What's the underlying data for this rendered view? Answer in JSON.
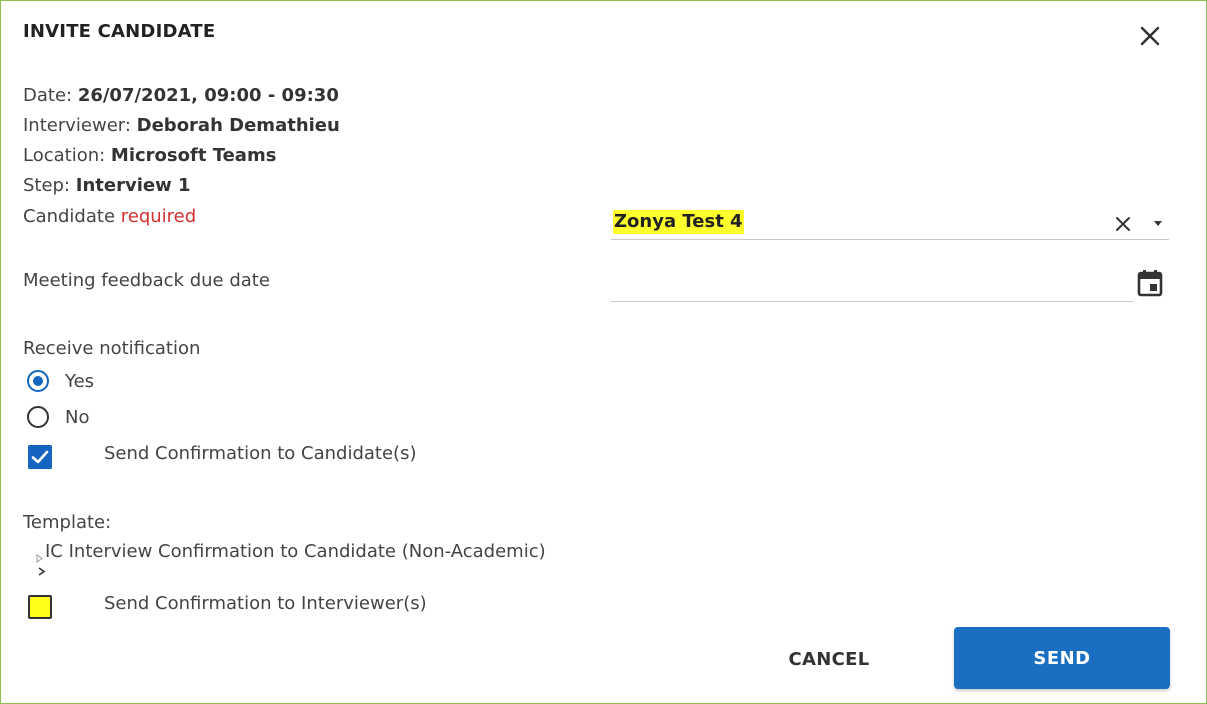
{
  "dialog": {
    "title": "INVITE CANDIDATE",
    "close_icon": "close-icon"
  },
  "info": {
    "date_label": "Date: ",
    "date_value": "26/07/2021, 09:00 - 09:30",
    "interviewer_label": "Interviewer: ",
    "interviewer_value": "Deborah Demathieu",
    "location_label": "Location: ",
    "location_value": "Microsoft Teams",
    "step_label": "Step: ",
    "step_value": "Interview 1"
  },
  "candidate": {
    "label": "Candidate",
    "required": "required",
    "value": "Zonya Test 4",
    "highlight_color": "#ffff2e"
  },
  "feedback_due": {
    "label": "Meeting feedback due date",
    "value": ""
  },
  "notification": {
    "label": "Receive notification",
    "options": [
      {
        "label": "Yes",
        "checked": true
      },
      {
        "label": "No",
        "checked": false
      }
    ]
  },
  "confirm_candidate": {
    "label": "Send Confirmation to Candidate(s)",
    "checked": true
  },
  "template": {
    "label": "Template:",
    "value": "IC Interview Confirmation to Candidate (Non-Academic)"
  },
  "confirm_interviewer": {
    "label": "Send Confirmation to Interviewer(s)",
    "checked": false
  },
  "actions": {
    "cancel": "CANCEL",
    "send": "SEND"
  },
  "colors": {
    "primary": "#1a6fc2",
    "required": "#d32f2f",
    "border": "#8bc34a"
  }
}
